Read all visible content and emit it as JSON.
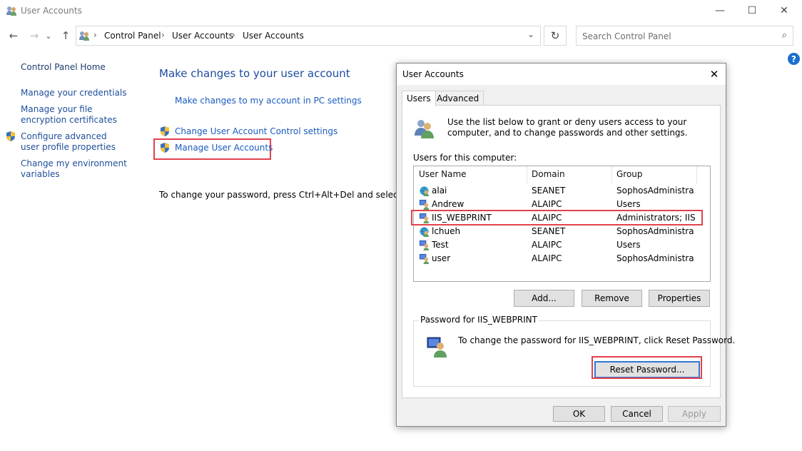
{
  "window": {
    "title": "User Accounts",
    "controls": {
      "minimize": "—",
      "maximize": "☐",
      "close": "✕"
    }
  },
  "nav": {
    "back": "←",
    "forward": "→",
    "recent": "⌄",
    "up": "↑",
    "breadcrumb": [
      "Control Panel",
      "User Accounts",
      "User Accounts"
    ],
    "separator": "›",
    "dropdown": "⌄",
    "refresh": "↻",
    "search_placeholder": "Search Control Panel",
    "search_icon": "⌕"
  },
  "help": "?",
  "sidebar": {
    "home": "Control Panel Home",
    "items": [
      "Manage your credentials",
      "Manage your file encryption certificates",
      "Configure advanced user profile properties",
      "Change my environment variables"
    ]
  },
  "main": {
    "title": "Make changes to your user account",
    "pc_settings_link": "Make changes to my account in PC settings",
    "uac_link": "Change User Account Control settings",
    "manage_link": "Manage User Accounts",
    "password_text": "To change your password, press Ctrl+Alt+Del and select Change"
  },
  "dialog": {
    "title": "User Accounts",
    "close": "✕",
    "tabs": [
      "Users",
      "Advanced"
    ],
    "active_tab": "Users",
    "intro": "Use the list below to grant or deny users access to your computer, and to change passwords and other settings.",
    "users_label": "Users for this computer:",
    "columns": [
      "User Name",
      "Domain",
      "Group"
    ],
    "users": [
      {
        "name": "alai",
        "domain": "SEANET",
        "group": "SophosAdministra...",
        "icon": "domain-user-icon"
      },
      {
        "name": "Andrew",
        "domain": "ALAIPC",
        "group": "Users",
        "icon": "local-user-icon"
      },
      {
        "name": "IIS_WEBPRINT",
        "domain": "ALAIPC",
        "group": "Administrators; IIS...",
        "icon": "local-user-icon",
        "selected": true
      },
      {
        "name": "lchueh",
        "domain": "SEANET",
        "group": "SophosAdministra...",
        "icon": "domain-user-icon"
      },
      {
        "name": "Test",
        "domain": "ALAIPC",
        "group": "Users",
        "icon": "local-user-icon"
      },
      {
        "name": "user",
        "domain": "ALAIPC",
        "group": "SophosAdministra...",
        "icon": "local-user-icon"
      }
    ],
    "buttons": {
      "add": "Add...",
      "remove": "Remove",
      "properties": "Properties"
    },
    "password_group": {
      "label": "Password for IIS_WEBPRINT",
      "info": "To change the password for IIS_WEBPRINT, click Reset Password.",
      "reset": "Reset Password..."
    },
    "footer": {
      "ok": "OK",
      "cancel": "Cancel",
      "apply": "Apply"
    }
  },
  "colors": {
    "link": "#1a5bbf",
    "highlight": "#e0424d",
    "title_blue": "#1e4ca0"
  }
}
